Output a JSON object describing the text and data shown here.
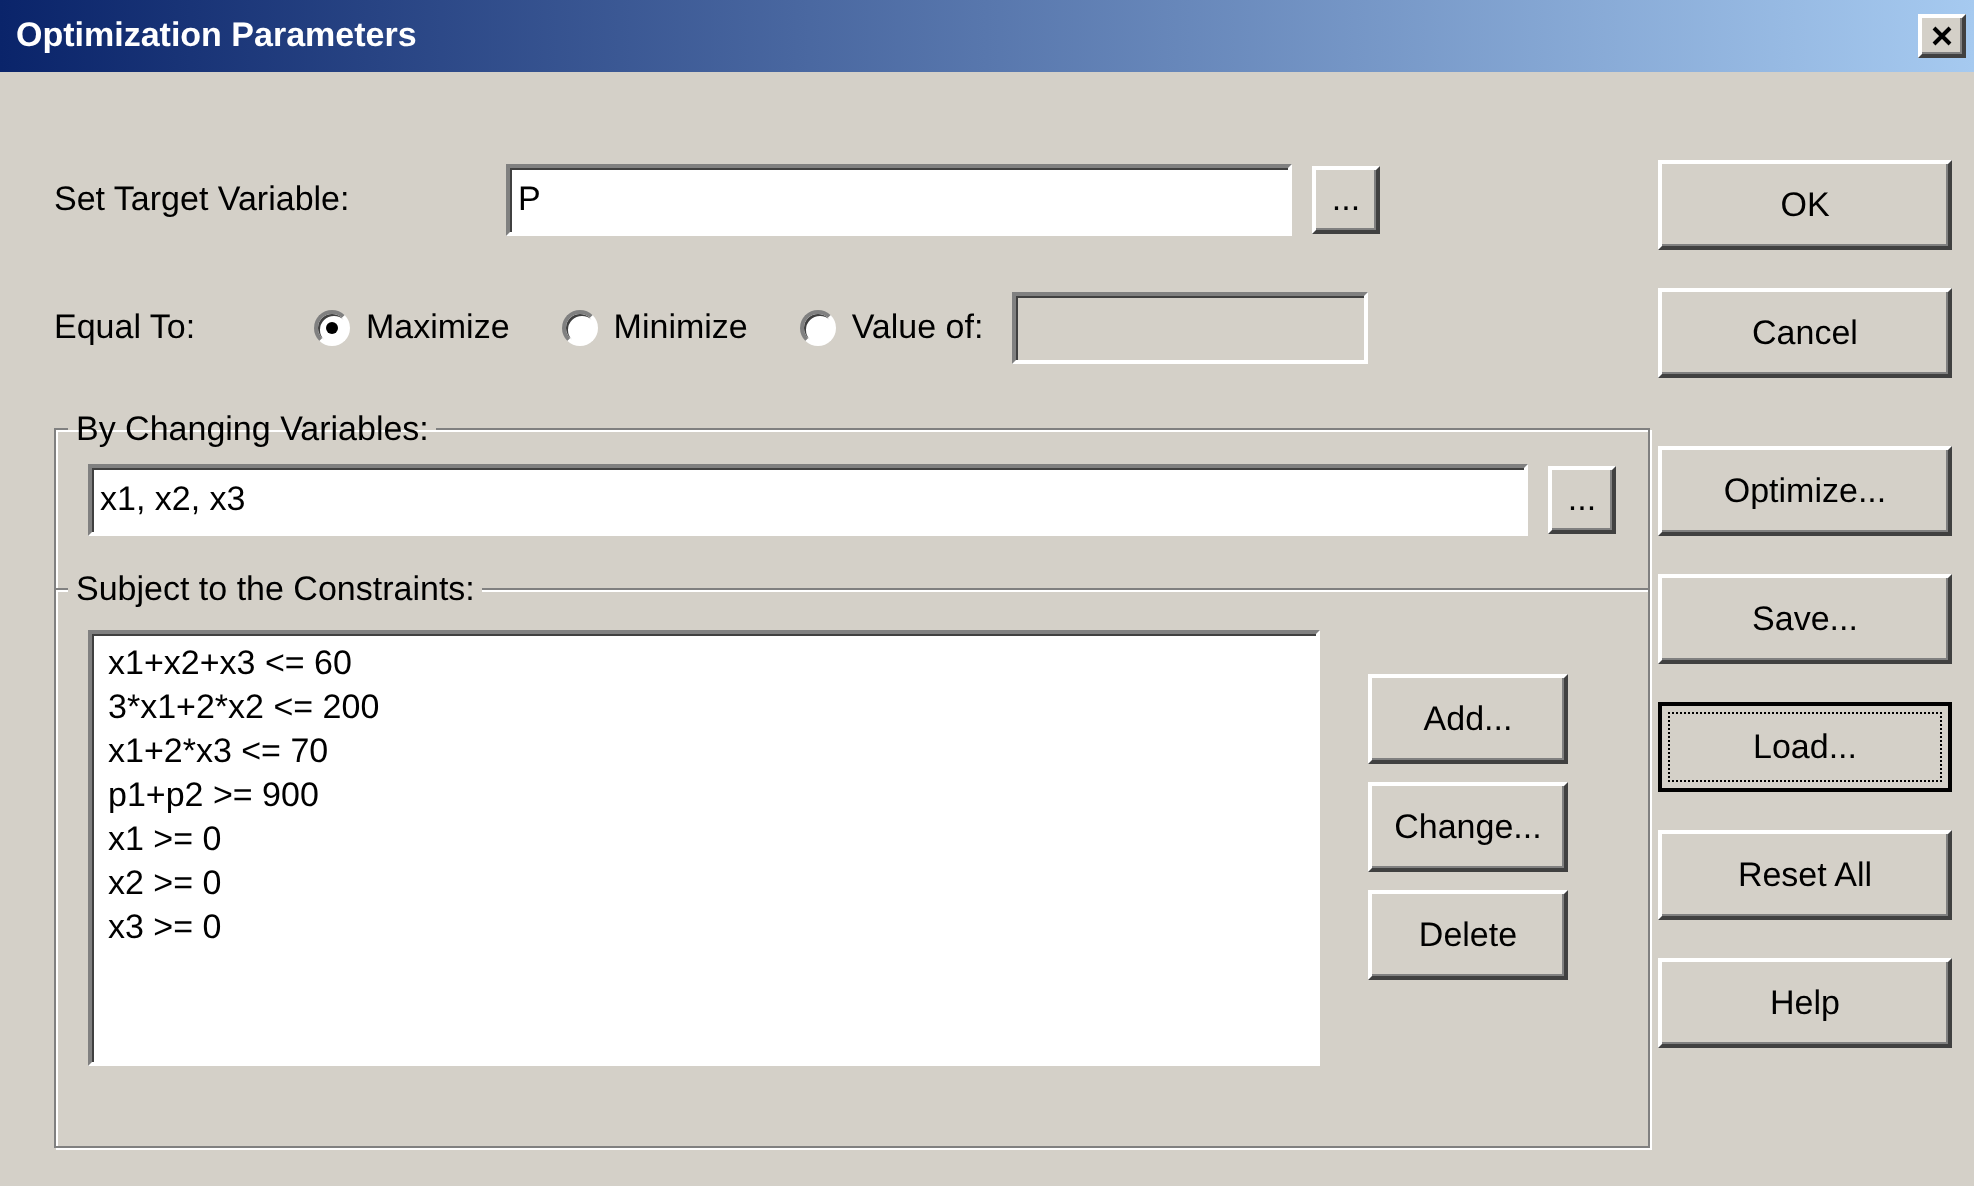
{
  "window": {
    "title": "Optimization Parameters"
  },
  "target": {
    "label": "Set Target Variable:",
    "value": "P",
    "browse": "..."
  },
  "equal_to": {
    "label": "Equal To:",
    "options": [
      {
        "label": "Maximize",
        "selected": true
      },
      {
        "label": "Minimize",
        "selected": false
      },
      {
        "label": "Value of:",
        "selected": false
      }
    ]
  },
  "changing": {
    "label": "By Changing Variables:",
    "value": "x1, x2, x3",
    "browse": "..."
  },
  "constraints": {
    "label": "Subject to the Constraints:",
    "items": [
      "x1+x2+x3 <= 60",
      "3*x1+2*x2 <= 200",
      "x1+2*x3 <= 70",
      "p1+p2 >= 900",
      "x1 >= 0",
      "x2 >= 0",
      "x3 >= 0"
    ],
    "buttons": [
      {
        "label": "Add..."
      },
      {
        "label": "Change..."
      },
      {
        "label": "Delete"
      }
    ]
  },
  "side_buttons": [
    {
      "label": "OK",
      "focused": false
    },
    {
      "label": "Cancel",
      "focused": false
    },
    {
      "label": "Optimize...",
      "focused": false
    },
    {
      "label": "Save...",
      "focused": false
    },
    {
      "label": "Load...",
      "focused": true
    },
    {
      "label": "Reset All",
      "focused": false
    },
    {
      "label": "Help",
      "focused": false
    }
  ]
}
